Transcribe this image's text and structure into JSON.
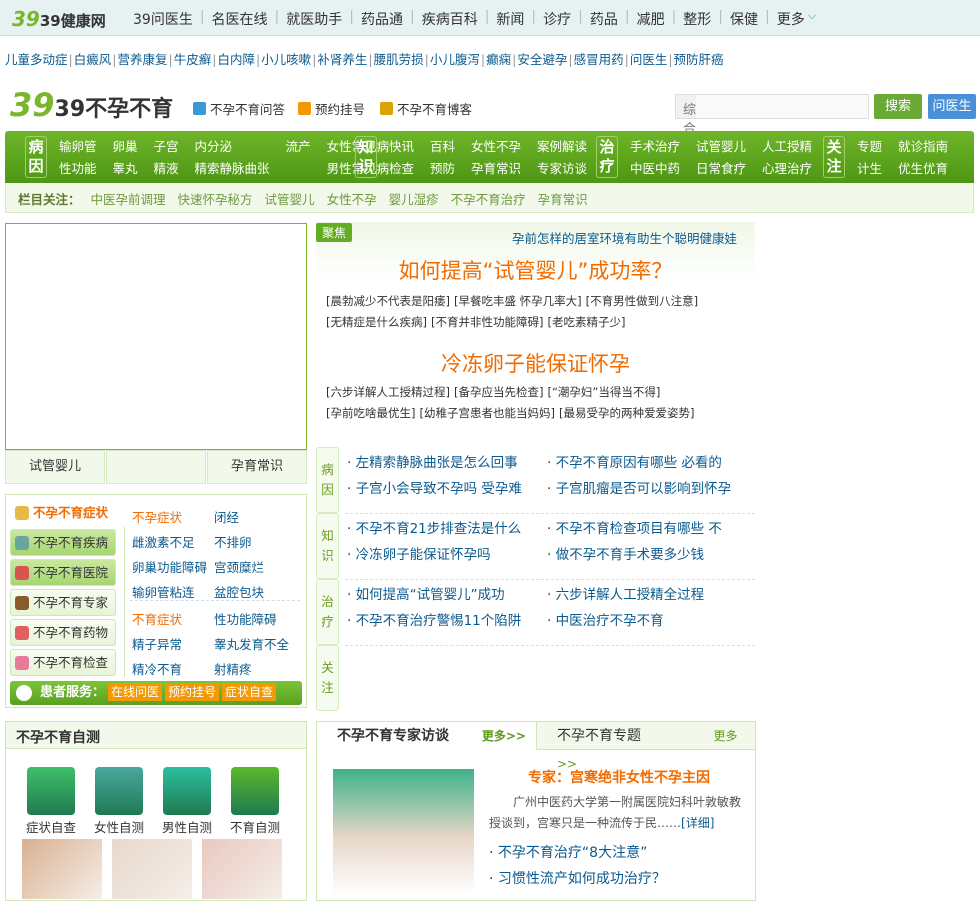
{
  "site": {
    "logo": "39健康网",
    "nav": [
      "39问医生",
      "名医在线",
      "就医助手",
      "药品通",
      "疾病百科",
      "新闻",
      "诊疗",
      "药品",
      "减肥",
      "整形",
      "保健",
      "更多"
    ]
  },
  "links": [
    "儿童多动症",
    "白癜风",
    "营养康复",
    "牛皮癣",
    "白内障",
    "小儿咳嗽",
    "补肾养生",
    "腰肌劳损",
    "小儿腹泻",
    "癫痫",
    "安全避孕",
    "感冒用药",
    "问医生",
    "预防肝癌"
  ],
  "channel": {
    "logo": "39不孕不育",
    "header_links": [
      "不孕不育问答",
      "预约挂号",
      "不孕不育博客"
    ],
    "search_scope": "综合",
    "search_placeholder": "",
    "search_button": "搜索",
    "ask_button": "问医生"
  },
  "green_nav": [
    {
      "cat": "病因",
      "items": [
        "输卵管",
        "性功能",
        "卵巢",
        "睾丸",
        "子宫",
        "精液",
        "内分泌",
        "精索静脉曲张",
        "流产",
        "",
        "女性常见病",
        "男性常见病"
      ]
    },
    {
      "cat": "知识",
      "items": [
        "快讯",
        "检查",
        "百科",
        "预防",
        "女性不孕",
        "孕育常识",
        "案例解读",
        "专家访谈"
      ]
    },
    {
      "cat": "治疗",
      "items": [
        "手术治疗",
        "中医中药",
        "试管婴儿",
        "日常食疗",
        "人工授精",
        "心理治疗"
      ]
    },
    {
      "cat": "关注",
      "items": [
        "专题",
        "计生",
        "就诊指南",
        "优生优育"
      ]
    }
  ],
  "focus_bar": {
    "label": "栏目关注：",
    "items": [
      "中医孕前调理",
      "快速怀孕秘方",
      "试管婴儿",
      "女性不孕",
      "婴儿湿疹",
      "不孕不育治疗",
      "孕育常识"
    ]
  },
  "slide_tabs": [
    "试管婴儿",
    "",
    "孕育常识"
  ],
  "symptoms": {
    "tabs": [
      "不孕不育症状",
      "不孕不育疾病",
      "不孕不育医院",
      "不孕不育专家",
      "不孕不育药物",
      "不孕不育检查"
    ],
    "female_title": "不孕症状",
    "female": [
      "闭经",
      "雌激素不足",
      "不排卵",
      "卵巢功能障碍",
      "宫颈糜烂",
      "输卵管粘连",
      "盆腔包块"
    ],
    "male_title": "不育症状",
    "male": [
      "性功能障碍",
      "精子异常",
      "睾丸发育不全",
      "精冷不育",
      "射精疼"
    ],
    "service_label": "患者服务：",
    "service": [
      "在线问医",
      "预约挂号",
      "症状自查"
    ]
  },
  "focus": {
    "tag": "聚焦",
    "top_link": "孕前怎样的居室环境有助生个聪明健康娃",
    "headline1": "如何提高“试管婴儿”成功率？",
    "links1": [
      "[晨勃减少不代表是阳痿]",
      "[早餐吃丰盛 怀孕几率大]",
      "[不育男性做到八注意]",
      "[无精症是什么疾病]",
      "[不育并非性功能障碍]",
      "[老吃素精子少]"
    ],
    "headline2": "冷冻卵子能保证怀孕",
    "links2": [
      "[六步详解人工授精过程]",
      "[备孕应当先检查]",
      "[“潮孕妇”当得当不得]",
      "[孕前吃啥最优生]",
      "[幼稚子宫患者也能当妈妈]",
      "[最易受孕的两种爱爱姿势]"
    ]
  },
  "categories": [
    {
      "label": "病因",
      "items": [
        "左精索静脉曲张是怎么回事",
        "不孕不育原因有哪些 必看的",
        "子宫小会导致不孕吗 受孕难",
        "子宫肌瘤是否可以影响到怀孕"
      ]
    },
    {
      "label": "知识",
      "items": [
        "不孕不育21步排查法是什么",
        "不孕不育检查项目有哪些 不",
        "冷冻卵子能保证怀孕吗",
        "做不孕不育手术要多少钱"
      ]
    },
    {
      "label": "治疗",
      "items": [
        "如何提高“试管婴儿”成功",
        "六步详解人工授精全过程",
        "不孕不育治疗警惕11个陷阱",
        "中医治疗不孕不育"
      ]
    },
    {
      "label": "关注",
      "items": []
    }
  ],
  "selftest": {
    "title": "不孕不育自测",
    "items": [
      "症状自查",
      "女性自测",
      "男性自测",
      "不育自测"
    ]
  },
  "expert": {
    "tab1": "不孕不育专家访谈",
    "tab2": "不孕不育专题",
    "more": "更多>>",
    "headline": "专家：宫寒绝非女性不孕主因",
    "summary": "广州中医药大学第一附属医院妇科叶敦敏教授谈到，宫寒只是一种流传于民……",
    "detail": "[详细]",
    "links": [
      "不孕不育治疗“8大注意”",
      "习惯性流产如何成功治疗？"
    ]
  },
  "colors": {
    "green": "#5ea51f",
    "orange": "#f26b00",
    "link": "#0b5a8e"
  }
}
